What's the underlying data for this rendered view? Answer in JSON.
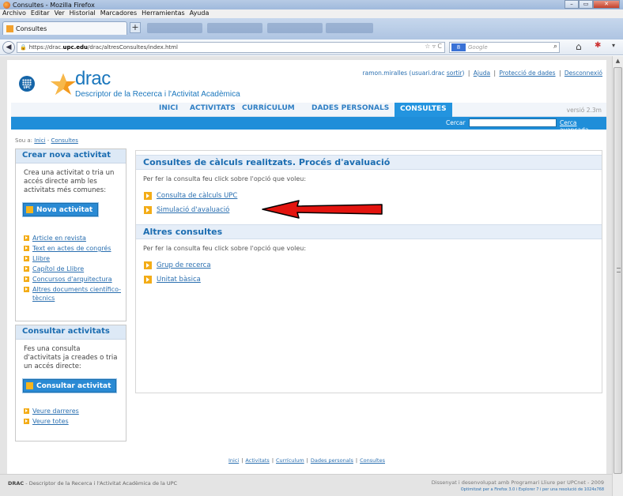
{
  "browser": {
    "window_title": "Consultes - Mozilla Firefox",
    "menu": [
      "Archivo",
      "Editar",
      "Ver",
      "Historial",
      "Marcadores",
      "Herramientas",
      "Ayuda"
    ],
    "active_tab": "Consultes",
    "url_host_prefix": "https://drac.",
    "url_host_bold": "upc.edu",
    "url_path": "/drac/altresConsultes/index.html",
    "search_engine": "8",
    "search_placeholder": "Google"
  },
  "header": {
    "brand": "drac",
    "subtitle": "Descriptor de la Recerca i l'Activitat Acadèmica",
    "user_name": "ramon.miralles (usuari.drac",
    "logout": "sortir",
    "close_paren": ")",
    "help": "Ajuda",
    "privacy": "Protecció de dades",
    "disconnect": "Desconnexió",
    "version": "versió 2.3m"
  },
  "nav": {
    "tabs": [
      "INICI",
      "ACTIVITATS",
      "CURRÍCULUM",
      "DADES PERSONALS",
      "CONSULTES"
    ],
    "active": "CONSULTES",
    "search_label": "Cercar",
    "advanced": "Cerca avançada"
  },
  "breadcrumb": {
    "prefix": "Sou a:",
    "home": "Inici",
    "sep": "-",
    "current": "Consultes"
  },
  "sidebar": {
    "create": {
      "title": "Crear nova activitat",
      "text": "Crea una activitat o tria un accés directe amb les activitats més comunes:",
      "button": "Nova activitat",
      "links": [
        "Article en revista",
        "Text en actes de congrés",
        "Llibre",
        "Capítol de Llibre",
        "Concursos d'arquitectura",
        "Altres documents científico-tècnics"
      ]
    },
    "consult": {
      "title": "Consultar activitats",
      "text": "Fes una consulta d'activitats ja creades o tria un accés directe:",
      "button": "Consultar activitat",
      "links": [
        "Veure darreres",
        "Veure totes"
      ]
    }
  },
  "main": {
    "section1": {
      "title": "Consultes de càlculs realitzats. Procés d'avaluació",
      "text": "Per fer la consulta feu click sobre l'opció que voleu:",
      "links": [
        "Consulta de càlculs UPC",
        "Simulació d'avaluació"
      ]
    },
    "section2": {
      "title": "Altres consultes",
      "text": "Per fer la consulta feu click sobre l'opció que voleu:",
      "links": [
        "Grup de recerca",
        "Unitat bàsica"
      ]
    }
  },
  "footer": {
    "links": [
      "Inici",
      "Activitats",
      "Currículum",
      "Dades personals",
      "Consultes"
    ],
    "left_bold": "DRAC",
    "left_text": "- Descriptor de la Recerca i l'Activitat Acadèmica de la UPC",
    "right_text": "Dissenyat i desenvolupat amb Programari Lliure per UPCnet - 2009",
    "right_small": "Optimitzat per a Firefox 3.0 i Explorer 7 i per una resolució de 1024x768"
  },
  "colors": {
    "brand_blue": "#1b77bd",
    "nav_active": "#2394df",
    "bullet": "#f3ac17",
    "arrow": "#e3140f"
  }
}
